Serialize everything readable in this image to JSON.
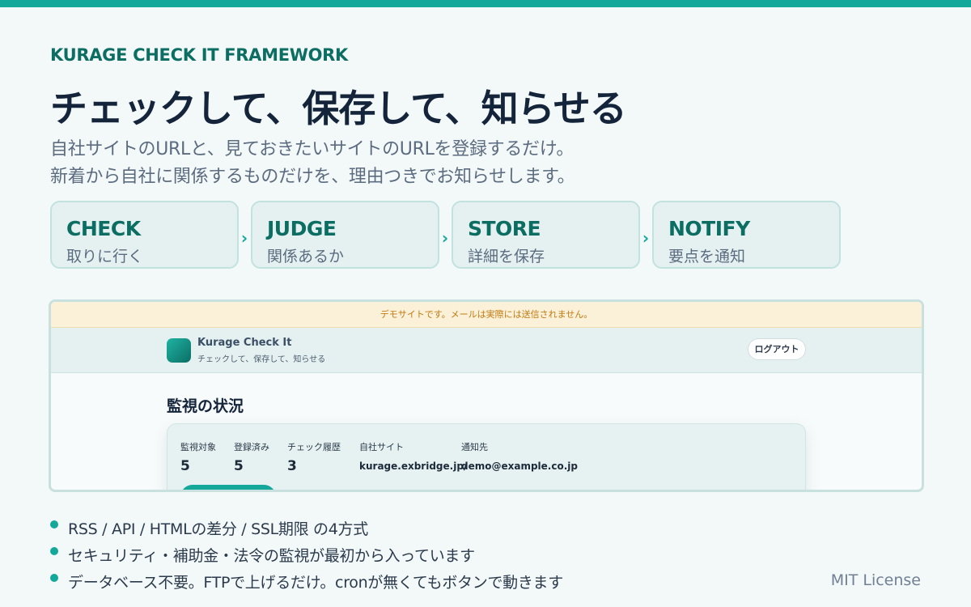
{
  "hero": {
    "eyebrow": "KURAGE CHECK IT FRAMEWORK",
    "headline": "チェックして、保存して、知らせる",
    "subline1": "自社サイトのURLと、見ておきたいサイトのURLを登録するだけ。",
    "subline2": "新着から自社に関係するものだけを、理由つきでお知らせします。"
  },
  "steps": [
    {
      "title": "CHECK",
      "subtitle": "取りに行く"
    },
    {
      "title": "JUDGE",
      "subtitle": "関係あるか"
    },
    {
      "title": "STORE",
      "subtitle": "詳細を保存"
    },
    {
      "title": "NOTIFY",
      "subtitle": "要点を通知"
    }
  ],
  "step_arrow": "›",
  "screenshot": {
    "demo_banner": "デモサイトです。メールは実際には送信されません。",
    "app_title": "Kurage Check It",
    "app_tagline": "チェックして、保存して、知らせる",
    "logout_label": "ログアウト",
    "section_title": "監視の状況",
    "stats": [
      {
        "label": "監視対象",
        "value": "5"
      },
      {
        "label": "登録済み",
        "value": "5"
      },
      {
        "label": "チェック履歴",
        "value": "3"
      },
      {
        "label": "自社サイト",
        "value": "kurage.exbridge.jp/"
      },
      {
        "label": "通知先",
        "value": "demo@example.co.jp"
      }
    ]
  },
  "bullets": [
    "RSS / API / HTMLの差分 / SSL期限 の4方式",
    "セキュリティ・補助金・法令の監視が最初から入っています",
    "データベース不要。FTPで上げるだけ。cronが無くてもボタンで動きます"
  ],
  "license": "MIT License",
  "colors": {
    "accent": "#14a89a",
    "accent_dark": "#0c6e63",
    "headline": "#14243a",
    "banner_bg": "#fbf1d8",
    "banner_text": "#c17a10"
  }
}
